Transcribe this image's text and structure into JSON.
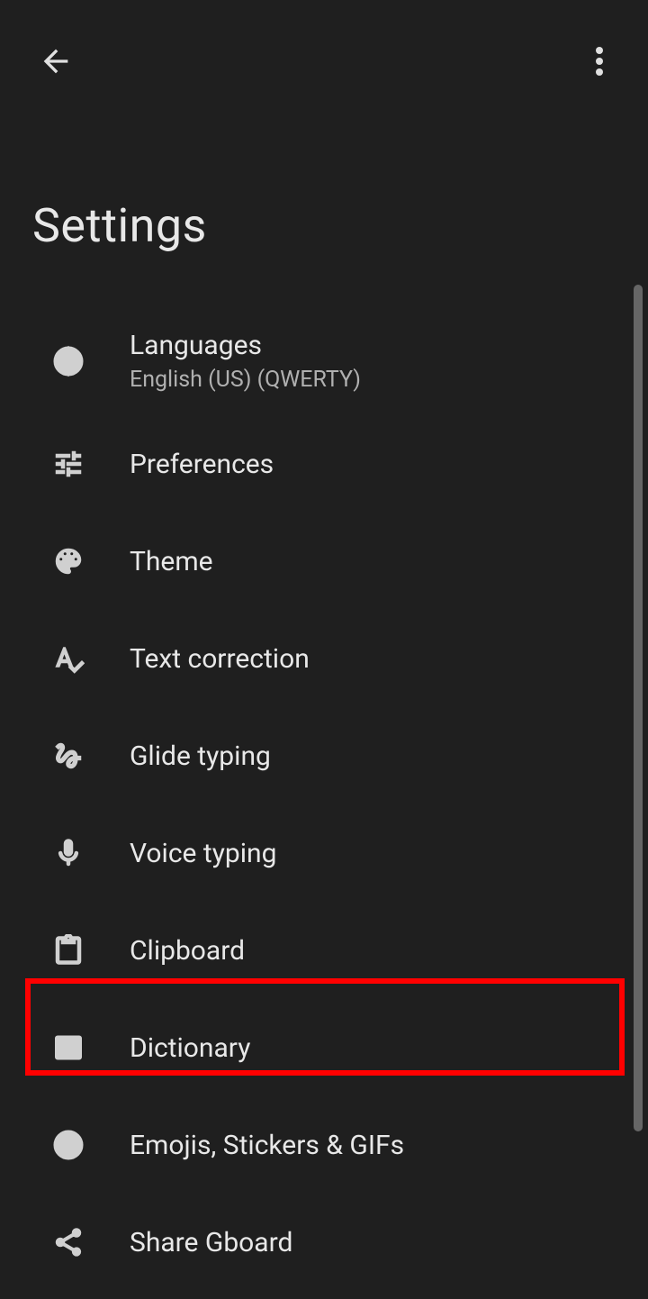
{
  "header": {
    "title": "Settings"
  },
  "items": [
    {
      "key": "languages",
      "label": "Languages",
      "sub": "English (US) (QWERTY)",
      "icon": "globe-icon"
    },
    {
      "key": "preferences",
      "label": "Preferences",
      "icon": "tune-icon"
    },
    {
      "key": "theme",
      "label": "Theme",
      "icon": "palette-icon"
    },
    {
      "key": "text-correction",
      "label": "Text correction",
      "icon": "spellcheck-icon"
    },
    {
      "key": "glide-typing",
      "label": "Glide typing",
      "icon": "gesture-icon"
    },
    {
      "key": "voice-typing",
      "label": "Voice typing",
      "icon": "mic-icon"
    },
    {
      "key": "clipboard",
      "label": "Clipboard",
      "icon": "clipboard-icon"
    },
    {
      "key": "dictionary",
      "label": "Dictionary",
      "icon": "book-icon",
      "highlighted": true
    },
    {
      "key": "emojis",
      "label": "Emojis, Stickers & GIFs",
      "icon": "emoji-icon"
    },
    {
      "key": "share",
      "label": "Share Gboard",
      "icon": "share-icon"
    }
  ]
}
